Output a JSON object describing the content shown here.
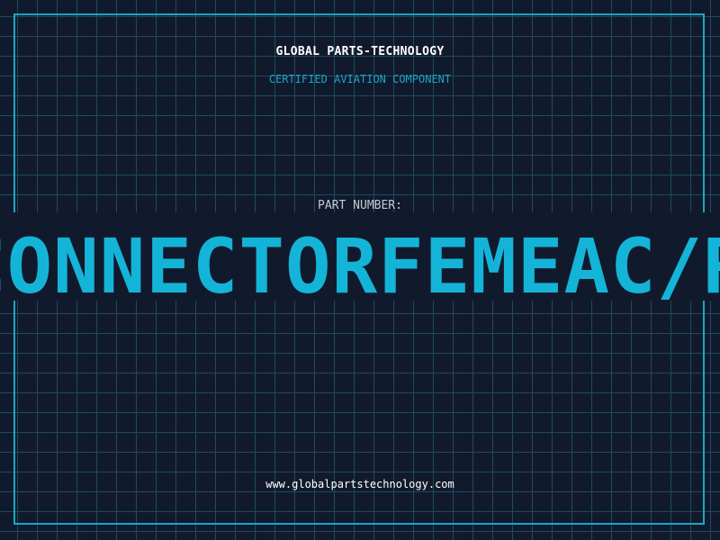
{
  "header": {
    "company": "GLOBAL PARTS-TECHNOLOGY",
    "subtitle": "CERTIFIED AVIATION COMPONENT"
  },
  "part": {
    "label": "PART NUMBER:",
    "value": "CONNECTORFEMEAC/ROSCAO"
  },
  "footer": {
    "url": "www.globalpartstechnology.com"
  },
  "colors": {
    "background": "#111a2c",
    "grid": "#1f4a5e",
    "accent": "#14b4d8",
    "text": "#ffffff"
  }
}
